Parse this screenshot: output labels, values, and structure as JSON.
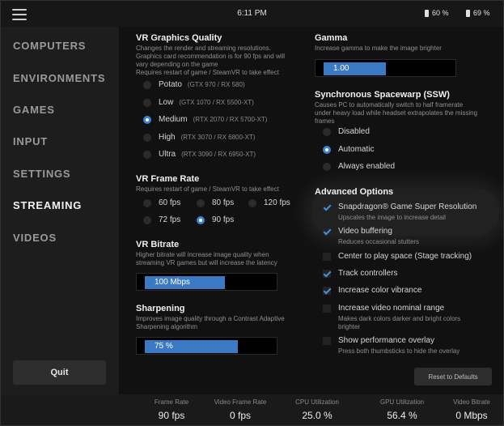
{
  "topbar": {
    "time": "6:11 PM",
    "battery_left": "60 %",
    "battery_right": "69 %"
  },
  "sidebar": {
    "items": [
      {
        "label": "COMPUTERS"
      },
      {
        "label": "ENVIRONMENTS"
      },
      {
        "label": "GAMES"
      },
      {
        "label": "INPUT"
      },
      {
        "label": "SETTINGS"
      },
      {
        "label": "STREAMING",
        "active": true
      },
      {
        "label": "VIDEOS"
      }
    ],
    "quit_label": "Quit"
  },
  "graphics": {
    "title": "VR Graphics Quality",
    "desc": [
      "Changes the render and streaming resolutions.",
      "Graphics card recommendation is for 90 fps and will",
      "vary depending on the game",
      "Requires restart of game / SteamVR to take effect"
    ],
    "options": [
      {
        "label": "Potato",
        "hint": "(GTX 970 / RX 580)",
        "selected": false
      },
      {
        "label": "Low",
        "hint": "(GTX 1070 / RX 5500-XT)",
        "selected": false
      },
      {
        "label": "Medium",
        "hint": "(RTX 2070 / RX 5700-XT)",
        "selected": true
      },
      {
        "label": "High",
        "hint": "(RTX 3070 / RX 6800-XT)",
        "selected": false
      },
      {
        "label": "Ultra",
        "hint": "(RTX 3090 / RX 6950-XT)",
        "selected": false
      }
    ]
  },
  "framerate": {
    "title": "VR Frame Rate",
    "desc": "Requires restart of game / SteamVR to take effect",
    "options": [
      {
        "label": "60 fps",
        "selected": false
      },
      {
        "label": "80 fps",
        "selected": false
      },
      {
        "label": "120 fps",
        "selected": false
      },
      {
        "label": "72 fps",
        "selected": false
      },
      {
        "label": "90 fps",
        "selected": true
      }
    ]
  },
  "bitrate": {
    "title": "VR Bitrate",
    "desc": [
      "Higher bitrate will increase image quality when",
      "streaming VR games but will increase the latency"
    ],
    "value": "100 Mbps",
    "fill_fraction": 0.65
  },
  "sharpening": {
    "title": "Sharpening",
    "desc": [
      "Improves image quality through a Contrast Adaptive",
      "Sharpening algorithm"
    ],
    "value": "75 %",
    "fill_fraction": 0.75
  },
  "gamma": {
    "title": "Gamma",
    "desc": "Increase gamma to make the image brighter",
    "value": "1.00",
    "fill_fraction": 0.5
  },
  "ssw": {
    "title": "Synchronous Spacewarp (SSW)",
    "desc": [
      "Causes PC to automatically switch to half framerate",
      "under heavy load while headset extrapolates the missing",
      "frames"
    ],
    "options": [
      {
        "label": "Disabled",
        "selected": false
      },
      {
        "label": "Automatic",
        "selected": true
      },
      {
        "label": "Always enabled",
        "selected": false
      }
    ]
  },
  "advanced": {
    "title": "Advanced Options",
    "options": [
      {
        "label": "Snapdragon® Game Super Resolution",
        "desc": "Upscales the image to increase detail",
        "checked": true
      },
      {
        "label": "Video buffering",
        "desc": "Reduces occasional stutters",
        "checked": true
      },
      {
        "label": "Center to play space (Stage tracking)",
        "checked": false
      },
      {
        "label": "Track controllers",
        "checked": true
      },
      {
        "label": "Increase color vibrance",
        "checked": true
      },
      {
        "label": "Increase video nominal range",
        "desc": "Makes dark colors darker and bright colors brighter",
        "checked": false
      },
      {
        "label": "Show performance overlay",
        "desc": "Press both thumbsticks to hide the overlay",
        "checked": false
      }
    ],
    "reset_label": "Reset to Defaults"
  },
  "stats": [
    {
      "label": "Frame Rate",
      "value": "90 fps"
    },
    {
      "label": "Video Frame Rate",
      "value": "0 fps"
    },
    {
      "label": "CPU Utilization",
      "value": "25.0 %"
    },
    {
      "label": "GPU Utilization",
      "value": "56.4 %"
    },
    {
      "label": "Video Bitrate",
      "value": "0 Mbps"
    }
  ],
  "colors": {
    "accent": "#3b79c4",
    "background": "#111111",
    "sidebar": "#1d1d1d"
  }
}
